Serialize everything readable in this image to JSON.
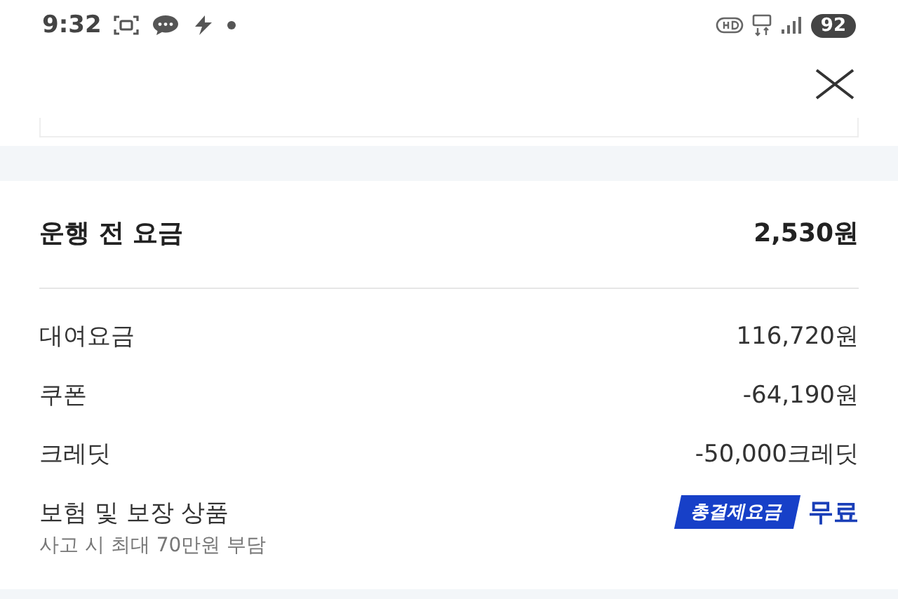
{
  "status_bar": {
    "time": "9:32",
    "battery": "92"
  },
  "summary": {
    "label": "운행 전 요금",
    "amount": "2,530원"
  },
  "items": [
    {
      "kind": "line",
      "label": "대여요금",
      "amount": "116,720원"
    },
    {
      "kind": "line",
      "label": "쿠폰",
      "amount": "-64,190원"
    },
    {
      "kind": "line",
      "label": "크레딧",
      "amount": "-50,000크레딧"
    },
    {
      "kind": "badge",
      "label": "보험 및 보장 상품",
      "note": "사고 시 최대 70만원 부담",
      "badge": "총결제요금",
      "amount": "무료"
    }
  ]
}
